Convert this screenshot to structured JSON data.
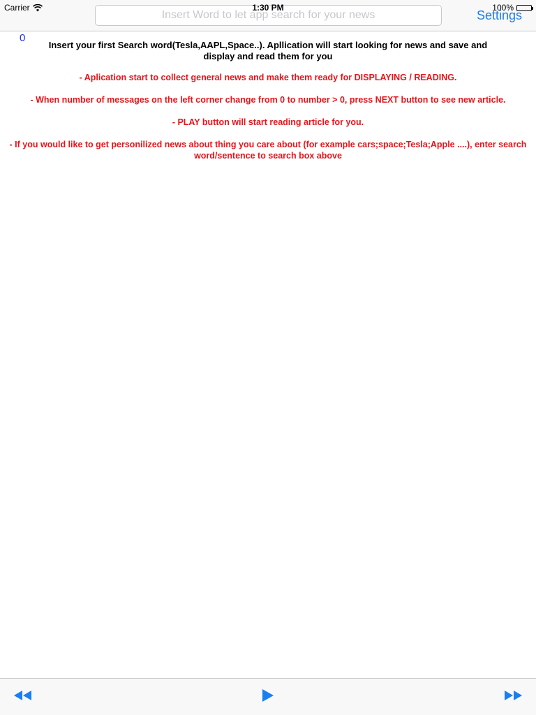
{
  "status_bar": {
    "carrier": "Carrier",
    "time": "1:30 PM",
    "battery": "100%"
  },
  "nav": {
    "search_placeholder": "Insert Word to let app search for your news",
    "search_value": "",
    "settings_label": "Settings"
  },
  "content": {
    "message_count": "0",
    "intro": "Insert your first Search word(Tesla,AAPL,Space..). Apllication will start looking for news and save and display and read them for you",
    "tips": [
      "- Aplication start to collect general news and make them ready for DISPLAYING / READING.",
      "- When number of messages on the left corner change from 0 to number > 0, press NEXT button to see new article.",
      "- PLAY button will start reading article for you.",
      "- If you would like to get personilized news about thing you care about (for example cars;space;Tesla;Apple ....), enter search word/sentence to search box above"
    ]
  },
  "toolbar": {
    "icons": [
      "rewind-icon",
      "play-icon",
      "fast-forward-icon"
    ]
  },
  "colors": {
    "accent": "#1a7ff0",
    "tip_text": "#e8141b",
    "count_text": "#1e2fe0"
  }
}
